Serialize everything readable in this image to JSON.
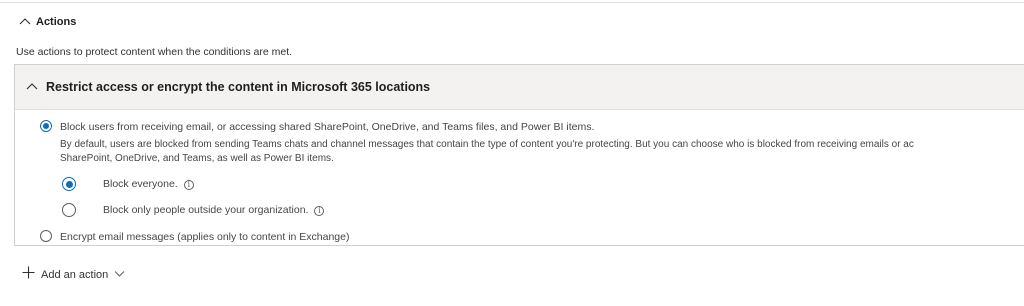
{
  "actions": {
    "title": "Actions",
    "description": "Use actions to protect content when the conditions are met."
  },
  "panel": {
    "title": "Restrict access or encrypt the content in Microsoft 365 locations",
    "option_block": {
      "label": "Block users from receiving email, or accessing shared SharePoint, OneDrive, and Teams files, and Power BI items.",
      "description_line1": "By default, users are blocked from sending Teams chats and channel messages that contain the type of content you're protecting. But you can choose who is blocked from receiving emails or ac",
      "description_line2": "SharePoint, OneDrive, and Teams, as well as Power BI items.",
      "selected": true
    },
    "sub_options": [
      {
        "label": "Block everyone.",
        "selected": true
      },
      {
        "label": "Block only people outside your organization.",
        "selected": false
      }
    ],
    "option_encrypt": {
      "label": "Encrypt email messages (applies only to content in Exchange)",
      "selected": false
    }
  },
  "add_action": {
    "label": "Add an action"
  },
  "icons": {
    "collapse": "chevron-up-icon",
    "info": "info-icon",
    "add": "plus-icon",
    "dropdown": "chevron-down-icon"
  },
  "colors": {
    "accent": "#0f6cbd",
    "header_bg": "#f3f2f1",
    "border": "#d2d0ce"
  }
}
